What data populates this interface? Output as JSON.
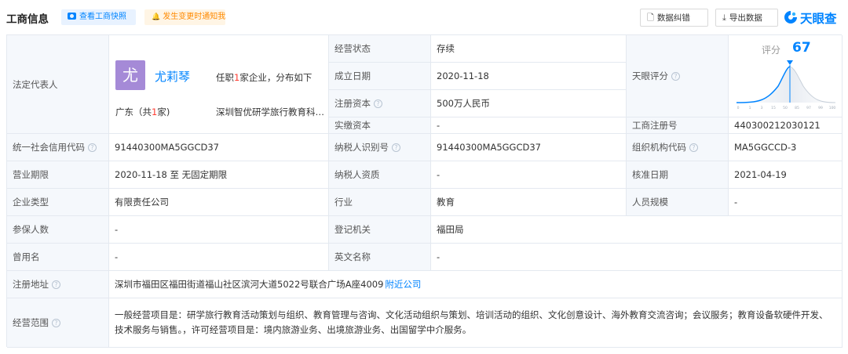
{
  "header": {
    "title": "工商信息",
    "snapshot_button": "查看工商快照",
    "notify_button": "发生变更时通知我",
    "correct_button": "数据纠错",
    "export_button": "导出数据",
    "logo_text": "天眼查"
  },
  "legal_rep": {
    "label": "法定代表人",
    "avatar_char": "尤",
    "name": "尤莉琴",
    "positions_pre": "任职",
    "positions_count": "1",
    "positions_post": "家企业，分布如下",
    "province_pre": "广东（共",
    "province_count": "1",
    "province_post": "家)",
    "company": "深圳智优研学旅行教育科技有限公司"
  },
  "rows": {
    "status_label": "经营状态",
    "status_value": "存续",
    "founded_label": "成立日期",
    "founded_value": "2020-11-18",
    "capital_label": "注册资本",
    "capital_value": "500万人民币",
    "paid_label": "实缴资本",
    "paid_value": "-",
    "score_label": "天眼评分",
    "regno_label": "工商注册号",
    "regno_value": "440300212030121",
    "credit_label": "统一社会信用代码",
    "credit_value": "91440300MA5GGCD37",
    "taxid_label": "纳税人识别号",
    "taxid_value": "91440300MA5GGCD37",
    "orgcode_label": "组织机构代码",
    "orgcode_value": "MA5GGCCD-3",
    "term_label": "营业期限",
    "term_value": "2020-11-18 至 无固定期限",
    "taxq_label": "纳税人资质",
    "taxq_value": "-",
    "approve_label": "核准日期",
    "approve_value": "2021-04-19",
    "type_label": "企业类型",
    "type_value": "有限责任公司",
    "industry_label": "行业",
    "industry_value": "教育",
    "staff_label": "人员规模",
    "staff_value": "-",
    "insured_label": "参保人数",
    "insured_value": "-",
    "authority_label": "登记机关",
    "authority_value": "福田局",
    "former_label": "曾用名",
    "former_value": "-",
    "english_label": "英文名称",
    "english_value": "-",
    "address_label": "注册地址",
    "address_value": "深圳市福田区福田街道福山社区滨河大道5022号联合广场A座4009",
    "address_link": "附近公司",
    "scope_label": "经营范围",
    "scope_value": "一般经营项目是：研学旅行教育活动策划与组织、教育管理与咨询、文化活动组织与策划、培训活动的组织、文化创意设计、海外教育交流咨询；会议服务；教育设备软硬件开发、技术服务与销售。，许可经营项目是：境内旅游业务、出境旅游业务、出国留学中介服务。"
  },
  "score": {
    "label": "评分",
    "value": "67",
    "ticks": [
      "0",
      "1",
      "3",
      "15",
      "50",
      "85",
      "97",
      "99",
      "100"
    ]
  },
  "colors": {
    "accent": "#0084ff",
    "highlight": "#ff3b30",
    "label_bg": "#f5f8fc",
    "border": "#e4e9f0",
    "avatar": "#a58ad7"
  }
}
